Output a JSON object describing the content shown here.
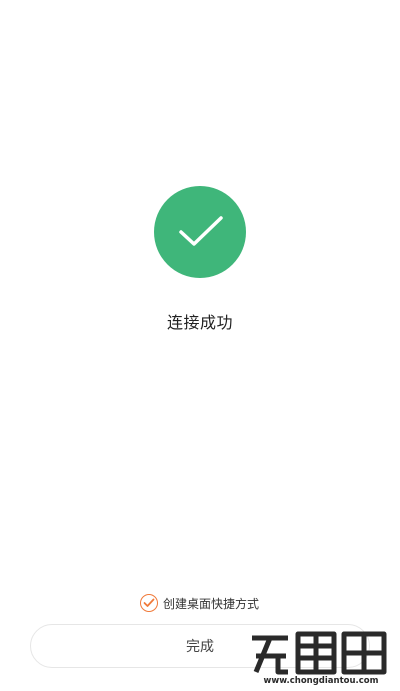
{
  "status": {
    "title": "连接成功",
    "icon": "check-icon"
  },
  "shortcut": {
    "label": "创建桌面快捷方式",
    "checked": true,
    "icon": "checkmark-icon"
  },
  "button": {
    "label": "完成"
  },
  "colors": {
    "success": "#3fb67a",
    "accent": "#f07a3a"
  },
  "watermark": {
    "logo_text": "充电头",
    "url": "www.chongdiantou.com"
  }
}
